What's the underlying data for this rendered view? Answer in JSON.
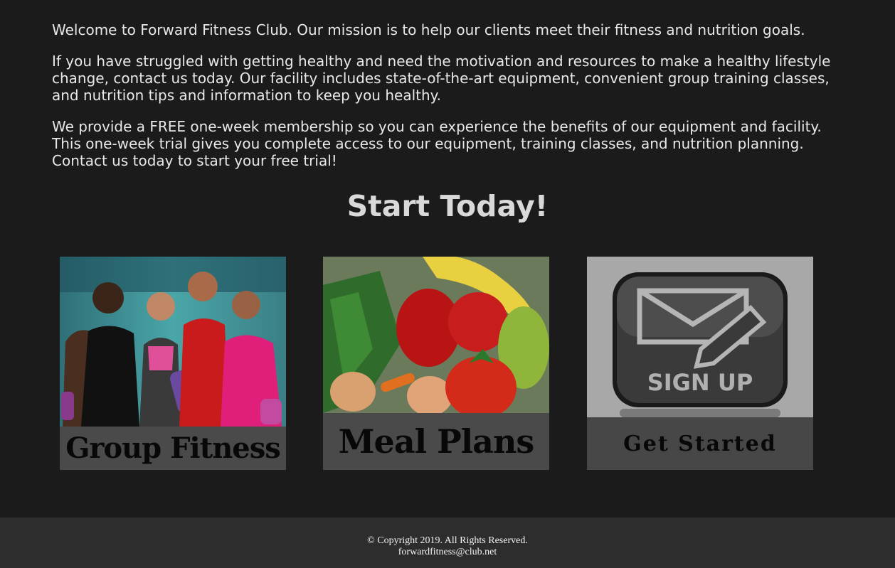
{
  "intro": {
    "p1": "Welcome to Forward Fitness Club. Our mission is to help our clients meet their fitness and nutrition goals.",
    "p2": "If you have struggled with getting healthy and need the motivation and resources to make a healthy lifestyle change, contact us today. Our facility includes state-of-the-art equipment, convenient group training classes, and nutrition tips and information to keep you healthy.",
    "p3": "We provide a FREE one-week membership so you can experience the benefits of our equipment and facility. This one-week trial gives you complete access to our equipment, training classes, and nutrition planning. Contact us today to start your free trial!"
  },
  "cta": {
    "title": "Start Today!"
  },
  "cards": [
    {
      "caption": "Group Fitness",
      "icon": "group-fitness-photo"
    },
    {
      "caption": "Meal Plans",
      "icon": "meal-plans-photo"
    },
    {
      "caption": "Get Started",
      "icon": "sign-up-icon",
      "badge_text": "SIGN UP"
    }
  ],
  "footer": {
    "copyright": "© Copyright 2019. All Rights Reserved.",
    "email": "forwardfitness@club.net"
  }
}
